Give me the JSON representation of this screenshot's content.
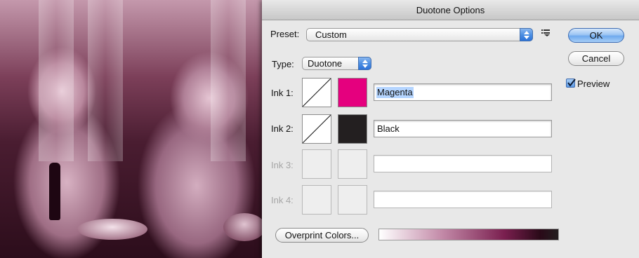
{
  "dialog": {
    "title": "Duotone Options",
    "preset": {
      "label": "Preset:",
      "value": "Custom"
    },
    "type": {
      "label": "Type:",
      "value": "Duotone"
    },
    "inks": [
      {
        "label": "Ink 1:",
        "name": "Magenta",
        "color": "#e5007e",
        "enabled": true,
        "selected": true
      },
      {
        "label": "Ink 2:",
        "name": "Black",
        "color": "#231f20",
        "enabled": true,
        "selected": false
      },
      {
        "label": "Ink 3:",
        "name": "",
        "color": "",
        "enabled": false,
        "selected": false
      },
      {
        "label": "Ink 4:",
        "name": "",
        "color": "",
        "enabled": false,
        "selected": false
      }
    ],
    "buttons": {
      "ok": "OK",
      "cancel": "Cancel",
      "overprint": "Overprint Colors..."
    },
    "preview": {
      "label": "Preview",
      "checked": true
    },
    "gradient_colors": [
      "#ffffff",
      "#e5007e",
      "#231f20"
    ]
  },
  "icons": {
    "preset_menu": "list-menu-icon",
    "popup_arrows": "up-down-arrows-icon",
    "checkmark": "checkmark-icon",
    "curve": "diagonal-curve-icon"
  }
}
